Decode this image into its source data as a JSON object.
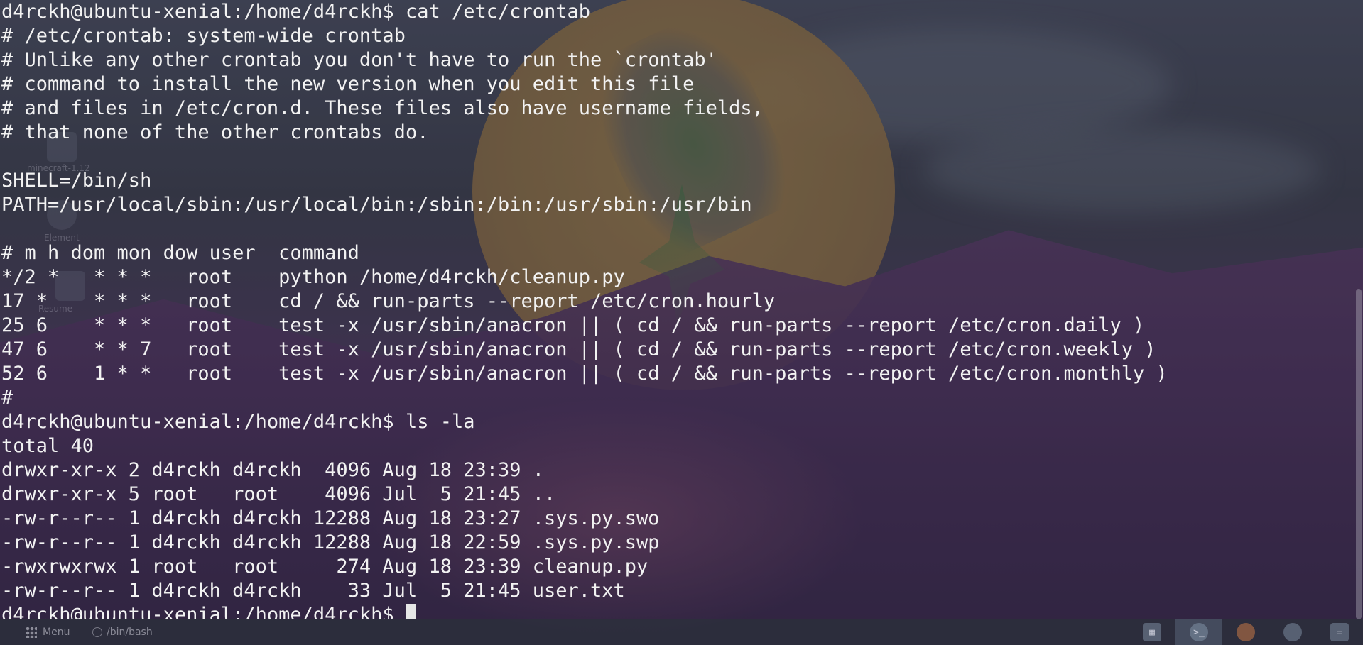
{
  "terminal": {
    "lines": [
      "d4rckh@ubuntu-xenial:/home/d4rckh$ cat /etc/crontab",
      "# /etc/crontab: system-wide crontab",
      "# Unlike any other crontab you don't have to run the `crontab'",
      "# command to install the new version when you edit this file",
      "# and files in /etc/cron.d. These files also have username fields,",
      "# that none of the other crontabs do.",
      "",
      "SHELL=/bin/sh",
      "PATH=/usr/local/sbin:/usr/local/bin:/sbin:/bin:/usr/sbin:/usr/bin",
      "",
      "# m h dom mon dow user  command",
      "*/2 *   * * *   root    python /home/d4rckh/cleanup.py",
      "17 *    * * *   root    cd / && run-parts --report /etc/cron.hourly",
      "25 6    * * *   root    test -x /usr/sbin/anacron || ( cd / && run-parts --report /etc/cron.daily )",
      "47 6    * * 7   root    test -x /usr/sbin/anacron || ( cd / && run-parts --report /etc/cron.weekly )",
      "52 6    1 * *   root    test -x /usr/sbin/anacron || ( cd / && run-parts --report /etc/cron.monthly )",
      "#",
      "d4rckh@ubuntu-xenial:/home/d4rckh$ ls -la",
      "total 40",
      "drwxr-xr-x 2 d4rckh d4rckh  4096 Aug 18 23:39 .",
      "drwxr-xr-x 5 root   root    4096 Jul  5 21:45 ..",
      "-rw-r--r-- 1 d4rckh d4rckh 12288 Aug 18 23:27 .sys.py.swo",
      "-rw-r--r-- 1 d4rckh d4rckh 12288 Aug 18 22:59 .sys.py.swp",
      "-rwxrwxrwx 1 root   root     274 Aug 18 23:39 cleanup.py",
      "-rw-r--r-- 1 d4rckh d4rckh    33 Jul  5 21:45 user.txt"
    ],
    "prompt": "d4rckh@ubuntu-xenial:/home/d4rckh$ "
  },
  "desktop": {
    "icons": [
      {
        "label": "minecraft-1.12"
      },
      {
        "label": "Element"
      },
      {
        "label": "Resume -"
      }
    ]
  },
  "taskbar": {
    "menu_label": "Menu",
    "task_label": "/bin/bash",
    "tray": [
      {
        "name": "system-monitor-icon"
      },
      {
        "name": "terminal-icon"
      },
      {
        "name": "firefox-icon"
      },
      {
        "name": "app-icon"
      },
      {
        "name": "files-icon"
      }
    ]
  }
}
